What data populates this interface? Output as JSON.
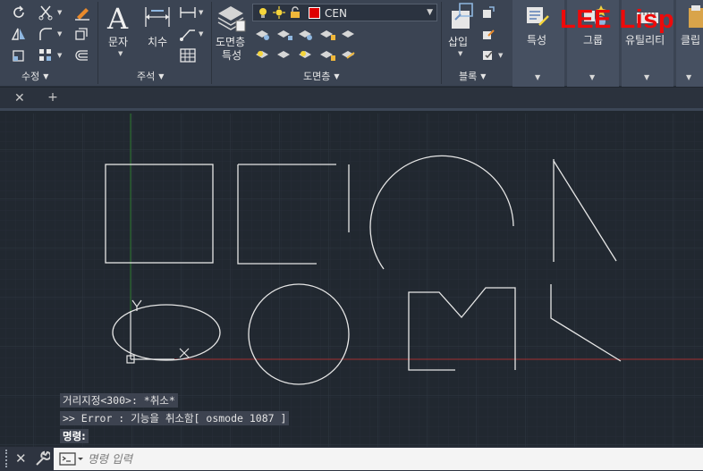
{
  "ribbon": {
    "panels": {
      "modify": {
        "label": "수정"
      },
      "annotation": {
        "label": "주석",
        "text_label": "문자",
        "dim_label": "치수"
      },
      "layers": {
        "label": "도면층",
        "properties_label_1": "도면층",
        "properties_label_2": "특성",
        "current_layer": "CEN",
        "current_layer_color": "#e00000"
      },
      "block": {
        "label": "블록",
        "insert_label": "삽입"
      },
      "properties": {
        "label": "특성"
      },
      "groups": {
        "label": "그룹"
      },
      "utilities": {
        "label": "유틸리티"
      },
      "clipboard": {
        "label": "클립"
      }
    },
    "watermark": "LEE Lisp"
  },
  "tabs": {
    "close_glyph": "✕",
    "add_glyph": "+"
  },
  "command_history": [
    "거리지정<300>: *취소*",
    ">> Error : 기능을 취소함[ osmode 1087 ]",
    "명령:"
  ],
  "command_line": {
    "placeholder": "명령 입력",
    "close_glyph": "✕"
  },
  "ucs": {
    "y_label": "Y"
  },
  "colors": {
    "canvas_bg": "#212830",
    "ribbon_bg": "#3b4453",
    "geometry": "#e6e6e6",
    "accent_red": "#e00000",
    "axis_x": "#a33030",
    "axis_y": "#2f7a2f"
  }
}
